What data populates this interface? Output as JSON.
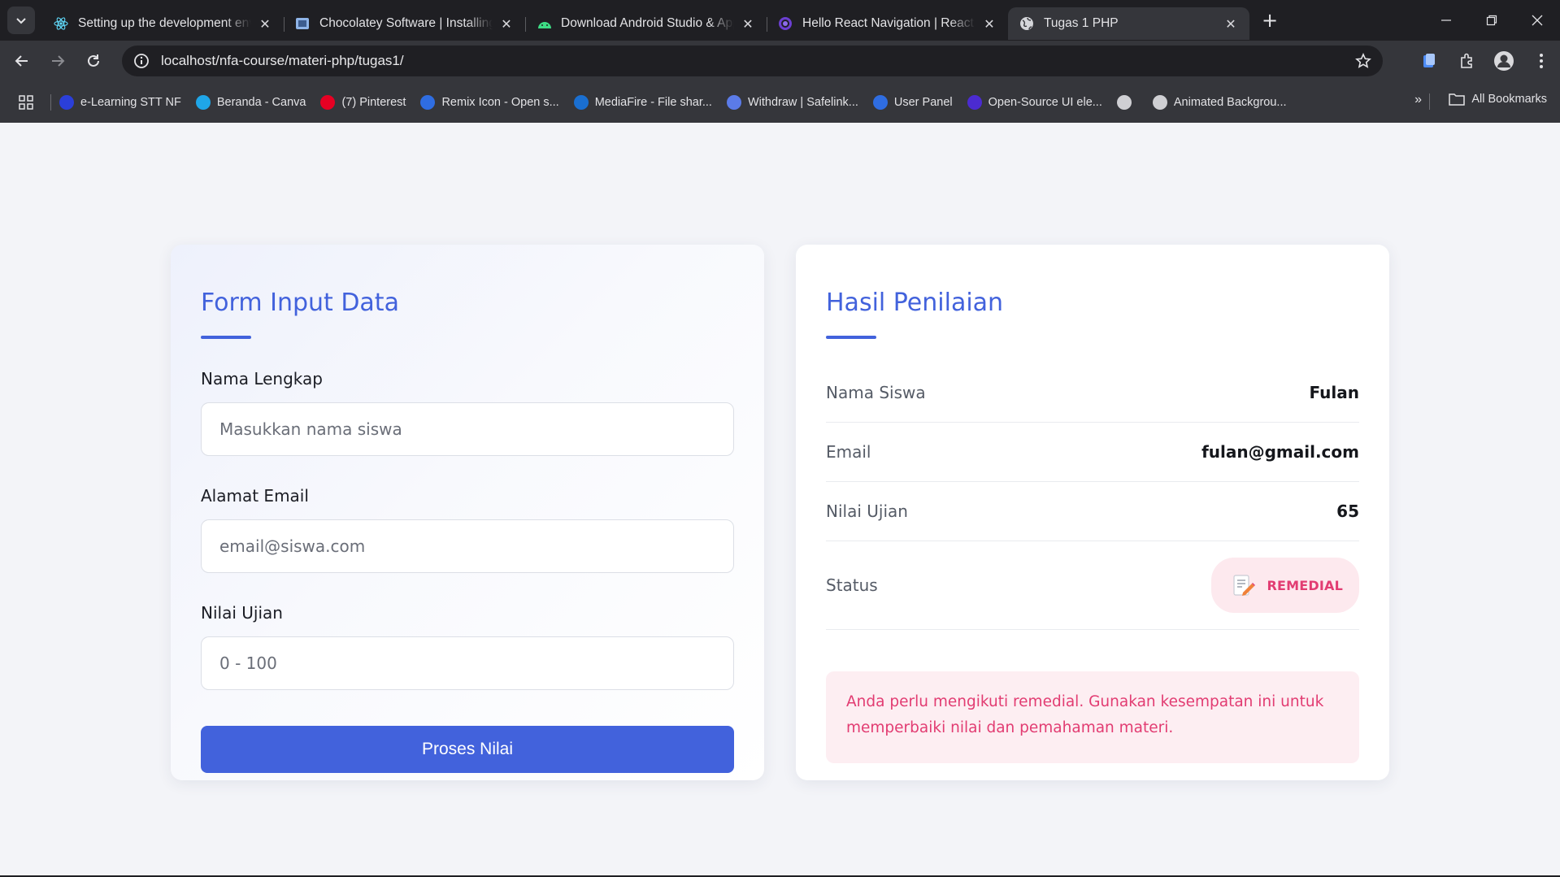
{
  "browser": {
    "tabs": [
      {
        "title": "Setting up the development environment",
        "icon": "react-icon",
        "active": false
      },
      {
        "title": "Chocolatey Software | Installing Chocolatey",
        "icon": "chocolatey-icon",
        "active": false
      },
      {
        "title": "Download Android Studio & App Tools",
        "icon": "android-icon",
        "active": false
      },
      {
        "title": "Hello React Navigation | React Navigation",
        "icon": "react-navigation-icon",
        "active": false
      },
      {
        "title": "Tugas 1 PHP",
        "icon": "globe-icon",
        "active": true
      }
    ],
    "url": "localhost/nfa-course/materi-php/tugas1/",
    "bookmarks": [
      {
        "label": "e-Learning STT NF",
        "color": "#2b3fd9"
      },
      {
        "label": "Beranda - Canva",
        "color": "#1fa6e8"
      },
      {
        "label": "(7) Pinterest",
        "color": "#e60023"
      },
      {
        "label": "Remix Icon - Open s...",
        "color": "#2f6de1"
      },
      {
        "label": "MediaFire - File shar...",
        "color": "#1a6fd1"
      },
      {
        "label": "Withdraw | Safelink...",
        "color": "#5b7be8"
      },
      {
        "label": "User Panel",
        "color": "#2f6de1"
      },
      {
        "label": "Open-Source UI ele...",
        "color": "#4b2bd1"
      },
      {
        "label": "",
        "color": "#cfcfd3"
      },
      {
        "label": "Animated Backgrou...",
        "color": "#cfcfd3"
      }
    ],
    "all_bookmarks": "All Bookmarks"
  },
  "form": {
    "title": "Form Input Data",
    "name_label": "Nama Lengkap",
    "name_placeholder": "Masukkan nama siswa",
    "email_label": "Alamat Email",
    "email_placeholder": "email@siswa.com",
    "score_label": "Nilai Ujian",
    "score_placeholder": "0 - 100",
    "submit_label": "Proses Nilai"
  },
  "result": {
    "title": "Hasil Penilaian",
    "rows": [
      {
        "key": "Nama Siswa",
        "value": "Fulan"
      },
      {
        "key": "Email",
        "value": "fulan@gmail.com"
      },
      {
        "key": "Nilai Ujian",
        "value": "65"
      }
    ],
    "status_label": "Status",
    "status_value": "REMEDIAL",
    "message": "Anda perlu mengikuti remedial. Gunakan kesempatan ini untuk memperbaiki nilai dan pemahaman materi."
  },
  "colors": {
    "accent": "#4262dc",
    "remedial": "#e23c72",
    "remedial_bg": "#fde9ee"
  }
}
